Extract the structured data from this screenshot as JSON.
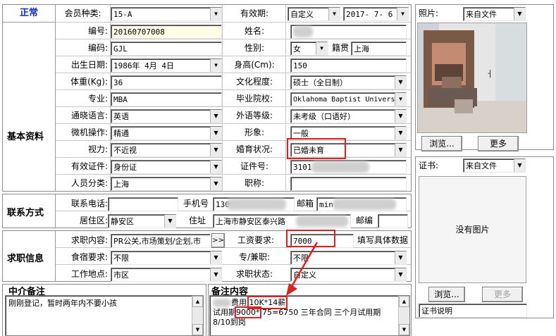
{
  "status": "正常",
  "basic_section_title": "基本资料",
  "contact_section_title": "联系方式",
  "job_section_title": "求职信息",
  "agency_notes_title": "中介备注",
  "notes_title": "备注内容",
  "member_type": {
    "label": "会员种类:",
    "value": "15-A"
  },
  "validity": {
    "label": "有效期:",
    "mode": "自定义",
    "date": "2017- 7- 6"
  },
  "member_no": {
    "label": "编号:",
    "value": "20160707008"
  },
  "name": {
    "label": "姓名:",
    "value": " "
  },
  "code": {
    "label": "编码:",
    "value": "GJL"
  },
  "gender": {
    "label": "性别:",
    "value": "女",
    "origin_label": "籍贯",
    "origin_value": "上海"
  },
  "birth": {
    "label": "出生日期:",
    "value": "1986年 4月 4日"
  },
  "height": {
    "label": "身高(Cm):",
    "value": "150"
  },
  "weight": {
    "label": "体重(Kg):",
    "value": "36"
  },
  "education": {
    "label": "文化程度:",
    "value": "硕士（全日制）"
  },
  "major": {
    "label": "专业:",
    "value": "MBA"
  },
  "school": {
    "label": "毕业院校:",
    "value": "Oklahoma Baptist University"
  },
  "language": {
    "label": "通晓语言:",
    "value": "英语"
  },
  "foreign_level": {
    "label": "外语等级:",
    "value": "未考级（口语好）"
  },
  "computer": {
    "label": "微机操作:",
    "value": "精通"
  },
  "appearance": {
    "label": "形象:",
    "value": "一般"
  },
  "vision": {
    "label": "视力:",
    "value": "不近视"
  },
  "marital": {
    "label": "婚育状况:",
    "value": "已婚未育"
  },
  "id_type": {
    "label": "有效证件:",
    "value": "身份证"
  },
  "id_no": {
    "label": "证件号:",
    "value": "3101"
  },
  "category": {
    "label": "人员分类:",
    "value": "上海"
  },
  "title": {
    "label": "职称:",
    "value": ""
  },
  "phone": {
    "label": "联系电话:",
    "value": ""
  },
  "mobile": {
    "label": "手机号",
    "value": "130"
  },
  "email": {
    "label": "邮箱",
    "value": "min"
  },
  "district": {
    "label": "居住区:",
    "value": "静安区"
  },
  "address": {
    "label": "住址",
    "value": "上海市静安区泰兴路"
  },
  "postcode": {
    "label": "邮编",
    "value": ""
  },
  "job_content": {
    "label": "求职内容:",
    "value": "PR公关,市场策划/企划,市",
    "button": ">>"
  },
  "salary": {
    "label": "工资要求:",
    "value": "7000",
    "hint": "填写具体数据"
  },
  "board": {
    "label": "食宿要求:",
    "value": "不限"
  },
  "fulltime": {
    "label": "专/兼职:",
    "value": "不限"
  },
  "location": {
    "label": "工作地点:",
    "value": "市区"
  },
  "job_status": {
    "label": "求职状态:",
    "value": "自定义"
  },
  "agency_notes_text": "刚刚登记，暂时两年内不要小孩",
  "notes": {
    "line1_suffix": "费用",
    "salary_hl": "10K*14薪",
    "line2_prefix": "试用期",
    "trial_hl": "9000*",
    "line2_rest": ".75=6750  三年合同  三个月试用期",
    "line3": "8/10到岗"
  },
  "photo": {
    "label": "照片:",
    "source": "来自文件",
    "browse": "浏览...",
    "more": "更多"
  },
  "cert": {
    "label": "证书:",
    "source": "来自文件",
    "no_image": "没有图片",
    "browse": "浏览...",
    "more": "更多",
    "desc": "证书说明"
  }
}
